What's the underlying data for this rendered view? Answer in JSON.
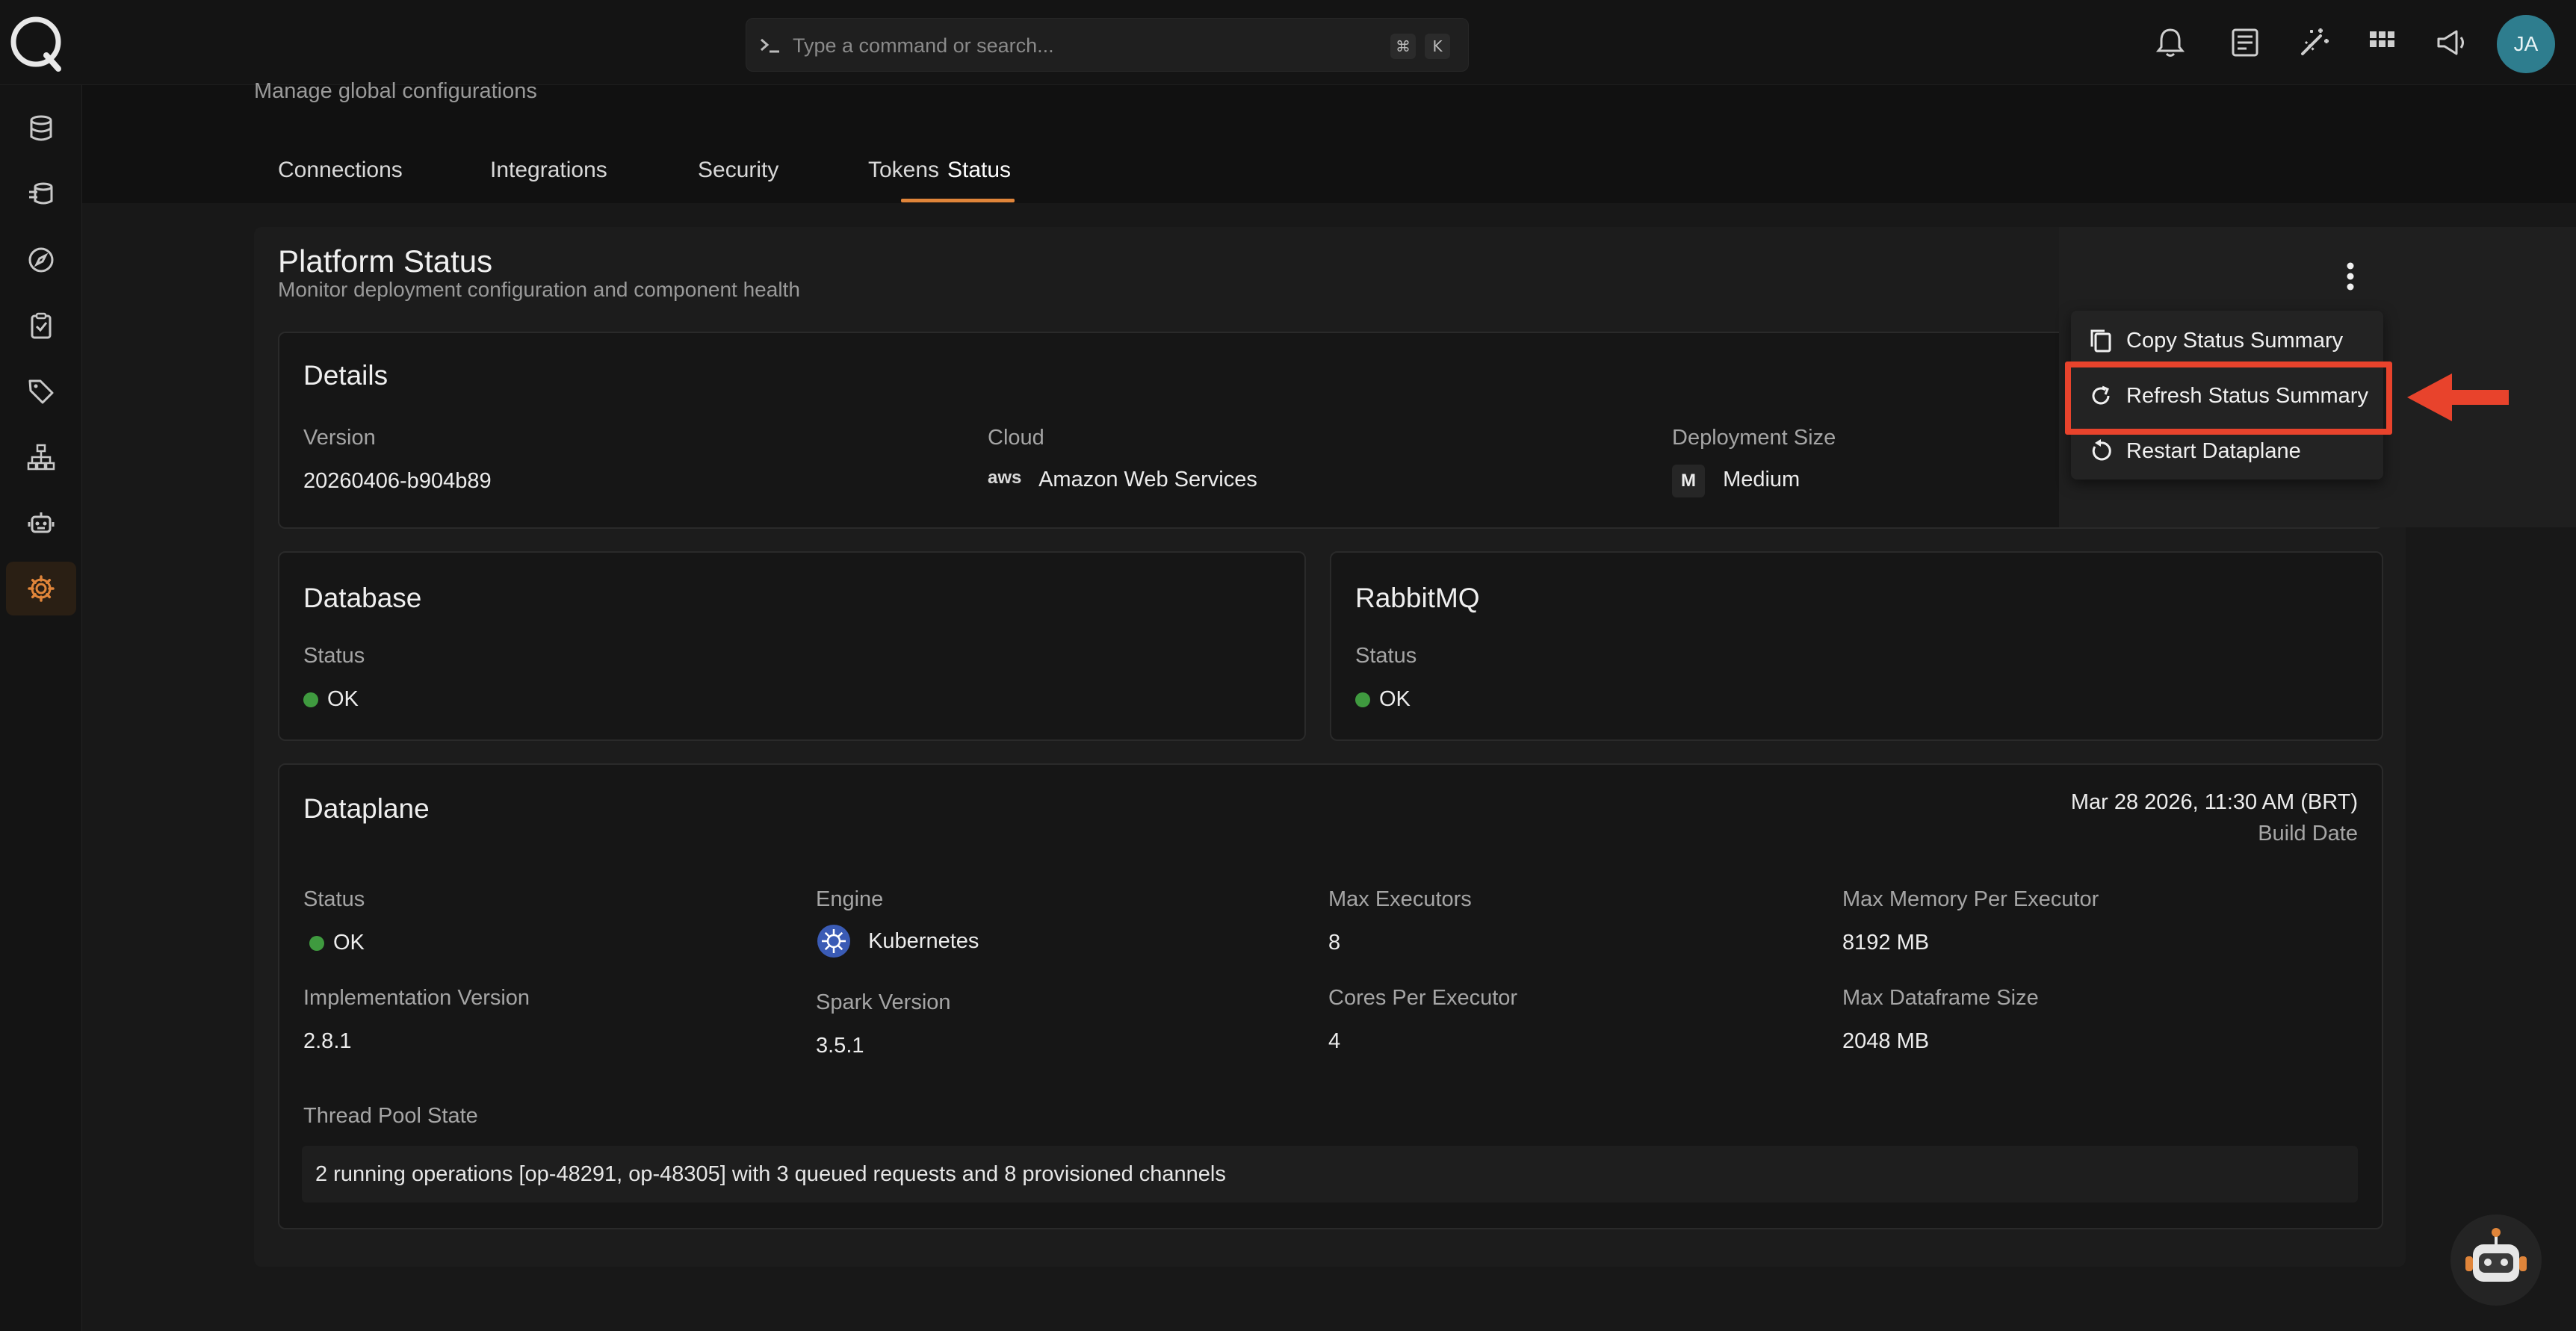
{
  "search": {
    "placeholder": "Type a command or search...",
    "shortcut_mod": "⌘",
    "shortcut_key": "K"
  },
  "user": {
    "initials": "JA"
  },
  "page": {
    "subtitle": "Manage global configurations"
  },
  "tabs": [
    {
      "label": "Connections"
    },
    {
      "label": "Integrations"
    },
    {
      "label": "Security"
    },
    {
      "label": "Tokens"
    },
    {
      "label": "Status",
      "active": true
    }
  ],
  "platform": {
    "title": "Platform Status",
    "subtitle": "Monitor deployment configuration and component health"
  },
  "details": {
    "title": "Details",
    "version_label": "Version",
    "version_value": "20260406-b904b89",
    "cloud_label": "Cloud",
    "cloud_value": "Amazon Web Services",
    "cloud_logo_text": "aws",
    "size_label": "Deployment Size",
    "size_value": "Medium",
    "size_badge": "M"
  },
  "database": {
    "title": "Database",
    "status_label": "Status",
    "status_value": "OK"
  },
  "rabbitmq": {
    "title": "RabbitMQ",
    "status_label": "Status",
    "status_value": "OK"
  },
  "dataplane": {
    "title": "Dataplane",
    "build_date": "Mar 28 2026, 11:30 AM (BRT)",
    "build_date_label": "Build Date",
    "status_label": "Status",
    "status_value": "OK",
    "engine_label": "Engine",
    "engine_value": "Kubernetes",
    "max_executors_label": "Max Executors",
    "max_executors_value": "8",
    "max_memory_label": "Max Memory Per Executor",
    "max_memory_value": "8192 MB",
    "impl_version_label": "Implementation Version",
    "impl_version_value": "2.8.1",
    "spark_version_label": "Spark Version",
    "spark_version_value": "3.5.1",
    "cores_label": "Cores Per Executor",
    "cores_value": "4",
    "max_df_label": "Max Dataframe Size",
    "max_df_value": "2048 MB",
    "thread_pool_label": "Thread Pool State",
    "thread_pool_value": "2 running operations [op-48291, op-48305] with 3 queued requests and 8 provisioned channels"
  },
  "menu": {
    "items": [
      {
        "label": "Copy Status Summary",
        "icon": "copy-icon"
      },
      {
        "label": "Refresh Status Summary",
        "icon": "refresh-icon",
        "highlighted": true
      },
      {
        "label": "Restart Dataplane",
        "icon": "restart-icon"
      }
    ]
  },
  "colors": {
    "accent": "#e0853a",
    "ok": "#3f9a3f",
    "highlight": "#e8432c",
    "avatar": "#2e7d8e"
  }
}
